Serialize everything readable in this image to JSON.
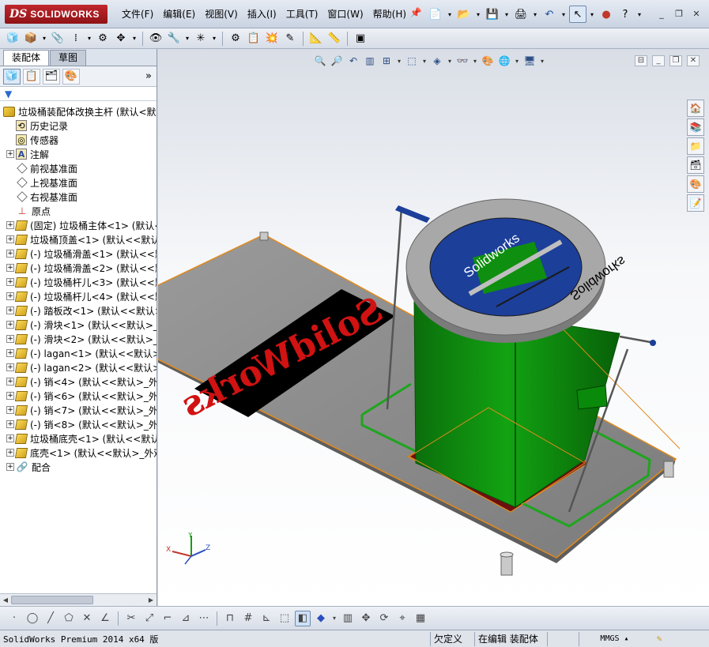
{
  "app": {
    "logo_ds": "DS",
    "logo_name": "SOLIDWORKS"
  },
  "menu": [
    "文件(F)",
    "编辑(E)",
    "视图(V)",
    "插入(I)",
    "工具(T)",
    "窗口(W)",
    "帮助(H)"
  ],
  "feature_manager": {
    "tabs": [
      "装配体",
      "草图"
    ],
    "selected_tab": "装配体",
    "more_label": "»",
    "tree": [
      {
        "label": "垃圾桶装配体改换主杆  (默认<默",
        "icon": "assembly-icon",
        "level": 0,
        "expand": ""
      },
      {
        "label": "历史记录",
        "icon": "history-icon",
        "level": 1,
        "expand": ""
      },
      {
        "label": "传感器",
        "icon": "sensor-icon",
        "level": 1,
        "expand": ""
      },
      {
        "label": "注解",
        "icon": "annotation-icon",
        "level": 1,
        "expand": "+"
      },
      {
        "label": "前视基准面",
        "icon": "plane-icon",
        "level": 1,
        "expand": ""
      },
      {
        "label": "上视基准面",
        "icon": "plane-icon",
        "level": 1,
        "expand": ""
      },
      {
        "label": "右视基准面",
        "icon": "plane-icon",
        "level": 1,
        "expand": ""
      },
      {
        "label": "原点",
        "icon": "origin-icon",
        "level": 1,
        "expand": ""
      },
      {
        "label": "(固定) 垃圾桶主体<1> (默认<",
        "icon": "part-icon",
        "level": 1,
        "expand": "+"
      },
      {
        "label": "垃圾桶顶盖<1> (默认<<默认>",
        "icon": "part-icon",
        "level": 1,
        "expand": "+"
      },
      {
        "label": "(-) 垃圾桶滑盖<1> (默认<<默",
        "icon": "part-icon",
        "level": 1,
        "expand": "+"
      },
      {
        "label": "(-) 垃圾桶滑盖<2> (默认<<默",
        "icon": "part-icon",
        "level": 1,
        "expand": "+"
      },
      {
        "label": "(-) 垃圾桶杆儿<3> (默认<<默",
        "icon": "part-icon",
        "level": 1,
        "expand": "+"
      },
      {
        "label": "(-) 垃圾桶杆儿<4> (默认<<默",
        "icon": "part-icon",
        "level": 1,
        "expand": "+"
      },
      {
        "label": "(-) 踏板改<1> (默认<<默认>",
        "icon": "part-icon",
        "level": 1,
        "expand": "+"
      },
      {
        "label": "(-) 滑块<1> (默认<<默认>_外",
        "icon": "part-icon",
        "level": 1,
        "expand": "+"
      },
      {
        "label": "(-) 滑块<2> (默认<<默认>_外",
        "icon": "part-icon",
        "level": 1,
        "expand": "+"
      },
      {
        "label": "(-) lagan<1> (默认<<默认>_",
        "icon": "part-icon",
        "level": 1,
        "expand": "+"
      },
      {
        "label": "(-) lagan<2> (默认<<默认>_",
        "icon": "part-icon",
        "level": 1,
        "expand": "+"
      },
      {
        "label": "(-) 销<4> (默认<<默认>_外观",
        "icon": "part-icon",
        "level": 1,
        "expand": "+"
      },
      {
        "label": "(-) 销<6> (默认<<默认>_外观",
        "icon": "part-icon",
        "level": 1,
        "expand": "+"
      },
      {
        "label": "(-) 销<7> (默认<<默认>_外观",
        "icon": "part-icon",
        "level": 1,
        "expand": "+"
      },
      {
        "label": "(-) 销<8> (默认<<默认>_外观",
        "icon": "part-icon",
        "level": 1,
        "expand": "+"
      },
      {
        "label": "垃圾桶底壳<1> (默认<<默认>",
        "icon": "part-icon",
        "level": 1,
        "expand": "+"
      },
      {
        "label": "底壳<1> (默认<<默认>_外观",
        "icon": "part-icon",
        "level": 1,
        "expand": "+"
      },
      {
        "label": "配合",
        "icon": "mate-icon",
        "level": 1,
        "expand": "+"
      }
    ]
  },
  "model_text": {
    "floor_logo": "SolidWorks",
    "lid_logo_1": "Solidworks",
    "lid_logo_2": "Solidworks"
  },
  "triad": {
    "x": "X",
    "y": "Y",
    "z": "Z"
  },
  "status": {
    "app_version": "SolidWorks Premium 2014 x64 版",
    "definition": "欠定义",
    "editing": "在编辑 装配体",
    "units": "MMGS"
  },
  "colors": {
    "bin_green": "#0a8a0a",
    "lid_gray": "#a8a8a8",
    "logo_blue": "#1c3f9a",
    "base_gray": "#8f8f8f",
    "edge_orange": "#e08a1e"
  }
}
